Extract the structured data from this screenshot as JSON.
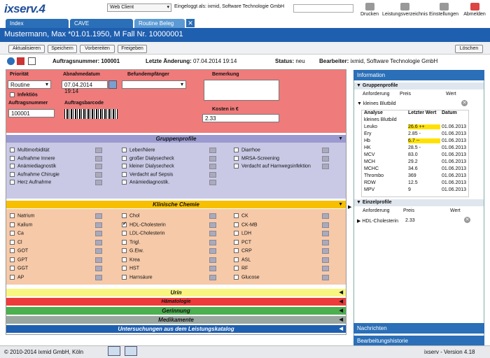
{
  "app": {
    "logo": "ixserv.",
    "logo_num": "4",
    "client": "Web Client",
    "login": "Eingeloggt als: ixmid, Software Technologie GmbH"
  },
  "toolbar": {
    "print": "Drucken",
    "services": "Leistungsverzeichnis",
    "settings": "Einstellungen",
    "logout": "Abmelden"
  },
  "tabs": [
    "Index",
    "CAVE",
    "Routine Beleg"
  ],
  "tab_close": "✕",
  "patient": "Mustermann, Max  *01.01.1950, M Fall Nr. 10000001",
  "actions": [
    "Aktualisieren",
    "Speichern",
    "Vorbereiten",
    "Freigeben"
  ],
  "delete": "Löschen",
  "order": {
    "num_label": "Auftragsnummer:",
    "num": "100001",
    "change_label": "Letzte Änderung:",
    "change": "07.04.2014 19:14",
    "status_label": "Status:",
    "status": "neu",
    "editor_label": "Bearbeiter:",
    "editor": "ixmid, Software Technologie GmbH"
  },
  "form": {
    "prio_label": "Priorität",
    "prio": "Routine",
    "infect": "Infektiös",
    "take_label": "Abnahmedatum",
    "take": "07.04.2014 19:14",
    "recv_label": "Befundempfänger",
    "remark_label": "Bemerkung",
    "order_label": "Auftragsnummer",
    "order_val": "100001",
    "barcode_label": "Auftragsbarcode",
    "cost_label": "Kosten in €",
    "cost": "2.33"
  },
  "bands": {
    "gp": "Gruppenprofile",
    "kc": "Klinische Chemie",
    "urin": "Urin",
    "ham": "Hämatologie",
    "ger": "Gerinnung",
    "med": "Medikamente",
    "kat": "Untersuchungen aus dem Leistungskatalog"
  },
  "gp_items": [
    [
      "Multimorbidität",
      "Leber/Niere",
      "Diarrhoe"
    ],
    [
      "Aufnahme Innere",
      "großer Dialysecheck",
      "MRSA-Screening"
    ],
    [
      "Anämiediagnostik",
      "kleiner Dialysecheck",
      "Verdacht auf Harnwegsinfektion"
    ],
    [
      "Aufnahme Chirugie",
      "Verdacht auf Sepsis",
      ""
    ],
    [
      "Herz Aufnahme",
      "Anämiediagnostik.",
      ""
    ]
  ],
  "kc_items": [
    [
      "Natrium",
      "Chol",
      "CK"
    ],
    [
      "Kalium",
      "HDL-Cholesterin",
      "CK-MB"
    ],
    [
      "Ca",
      "LDL-Cholesterin",
      "LDH"
    ],
    [
      "Cl",
      "Trigl.",
      "PCT"
    ],
    [
      "GOT",
      "G.Eiw.",
      "CRP"
    ],
    [
      "GPT",
      "Krea",
      "ASL"
    ],
    [
      "GGT",
      "HST",
      "RF"
    ],
    [
      "AP",
      "Harnsäure",
      "Glucose"
    ]
  ],
  "side": {
    "info": "Information",
    "gp": "Gruppenprofile",
    "gp_cols": [
      "Anforderung",
      "Preis",
      "Wert"
    ],
    "gp_row": "kleines Blutbild",
    "an_cols": [
      "Analyse",
      "Letzter Wert",
      "Datum"
    ],
    "an_rows": [
      [
        "kleines Blutbild",
        "",
        ""
      ],
      [
        "Leuko",
        "26.6 ++",
        "01.06.2013"
      ],
      [
        "Ery",
        "2.85 -",
        "01.06.2013"
      ],
      [
        "Hb",
        "6.7 --",
        "01.06.2013"
      ],
      [
        "HK",
        "28.5 -",
        "01.06.2013"
      ],
      [
        "MCV",
        "83.0",
        "01.06.2013"
      ],
      [
        "MCH",
        "29.2",
        "01.06.2013"
      ],
      [
        "MCHC",
        "34.6",
        "01.06.2013"
      ],
      [
        "Thrombo",
        "369",
        "01.06.2013"
      ],
      [
        "RDW",
        "12.5",
        "01.06.2013"
      ],
      [
        "MPV",
        "9",
        "01.06.2013"
      ]
    ],
    "ep": "Einzelprofile",
    "ep_cols": [
      "Anforderung",
      "Preis",
      "Wert"
    ],
    "ep_row": [
      "HDL-Cholesterin",
      "2.33"
    ],
    "notes": "Nachrichten",
    "history": "Bearbeitungshistorie"
  },
  "status": {
    "copyright": "© 2010-2014 ixmid GmbH, Köln",
    "version": "ixserv - Version 4.18"
  }
}
